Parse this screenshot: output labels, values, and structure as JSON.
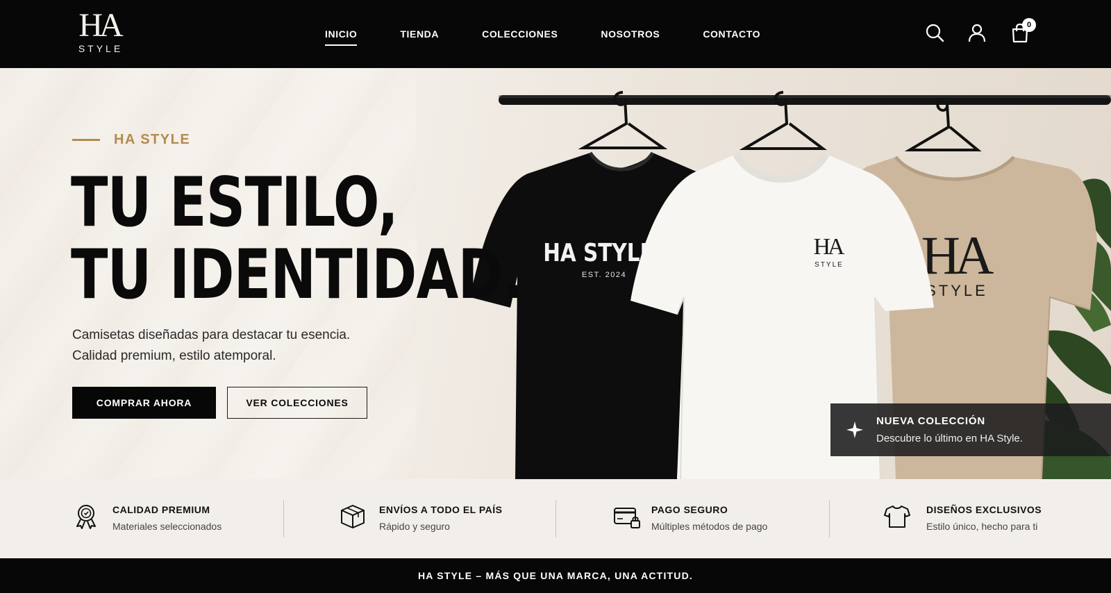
{
  "brand": {
    "logo_mark": "HA",
    "logo_sub": "STYLE"
  },
  "nav": {
    "items": [
      {
        "label": "INICIO",
        "active": true
      },
      {
        "label": "TIENDA"
      },
      {
        "label": "COLECCIONES"
      },
      {
        "label": "NOSOTROS"
      },
      {
        "label": "CONTACTO"
      }
    ]
  },
  "header_icons": [
    "search-icon",
    "user-icon",
    "cart-icon"
  ],
  "cart": {
    "count": "0"
  },
  "hero": {
    "eyebrow": "HA STYLE",
    "headline_line1": "TU ESTILO,",
    "headline_line2": "TU IDENTIDAD.",
    "sub_line1": "Camisetas diseñadas para destacar tu esencia.",
    "sub_line2": "Calidad premium, estilo atemporal.",
    "primary_button": "COMPRAR AHORA",
    "secondary_button": "VER COLECCIONES",
    "shirts": {
      "black": {
        "print": "HA STYLE",
        "sub": "EST. 2024",
        "color": "#0d0d0d"
      },
      "white": {
        "logo_mark": "HA",
        "logo_sub": "STYLE",
        "color": "#f7f6f3"
      },
      "beige": {
        "logo_mark": "HA",
        "logo_sub": "STYLE",
        "color": "#cdb79c"
      }
    }
  },
  "callout": {
    "icon": "sparkle-icon",
    "title": "NUEVA COLECCIÓN",
    "text": "Descubre lo último en HA Style."
  },
  "features": [
    {
      "icon": "award-icon",
      "title": "CALIDAD PREMIUM",
      "text": "Materiales seleccionados"
    },
    {
      "icon": "box-icon",
      "title": "ENVÍOS A TODO EL PAÍS",
      "text": "Rápido y seguro"
    },
    {
      "icon": "card-lock-icon",
      "title": "PAGO SEGURO",
      "text": "Múltiples métodos de pago"
    },
    {
      "icon": "tshirt-icon",
      "title": "DISEÑOS EXCLUSIVOS",
      "text": "Estilo único, hecho para ti"
    }
  ],
  "footer": {
    "tagline": "HA STYLE – MÁS QUE UNA MARCA, UNA ACTITUD."
  },
  "colors": {
    "accent": "#b38a4f",
    "dark": "#070707",
    "light": "#f2efea"
  }
}
